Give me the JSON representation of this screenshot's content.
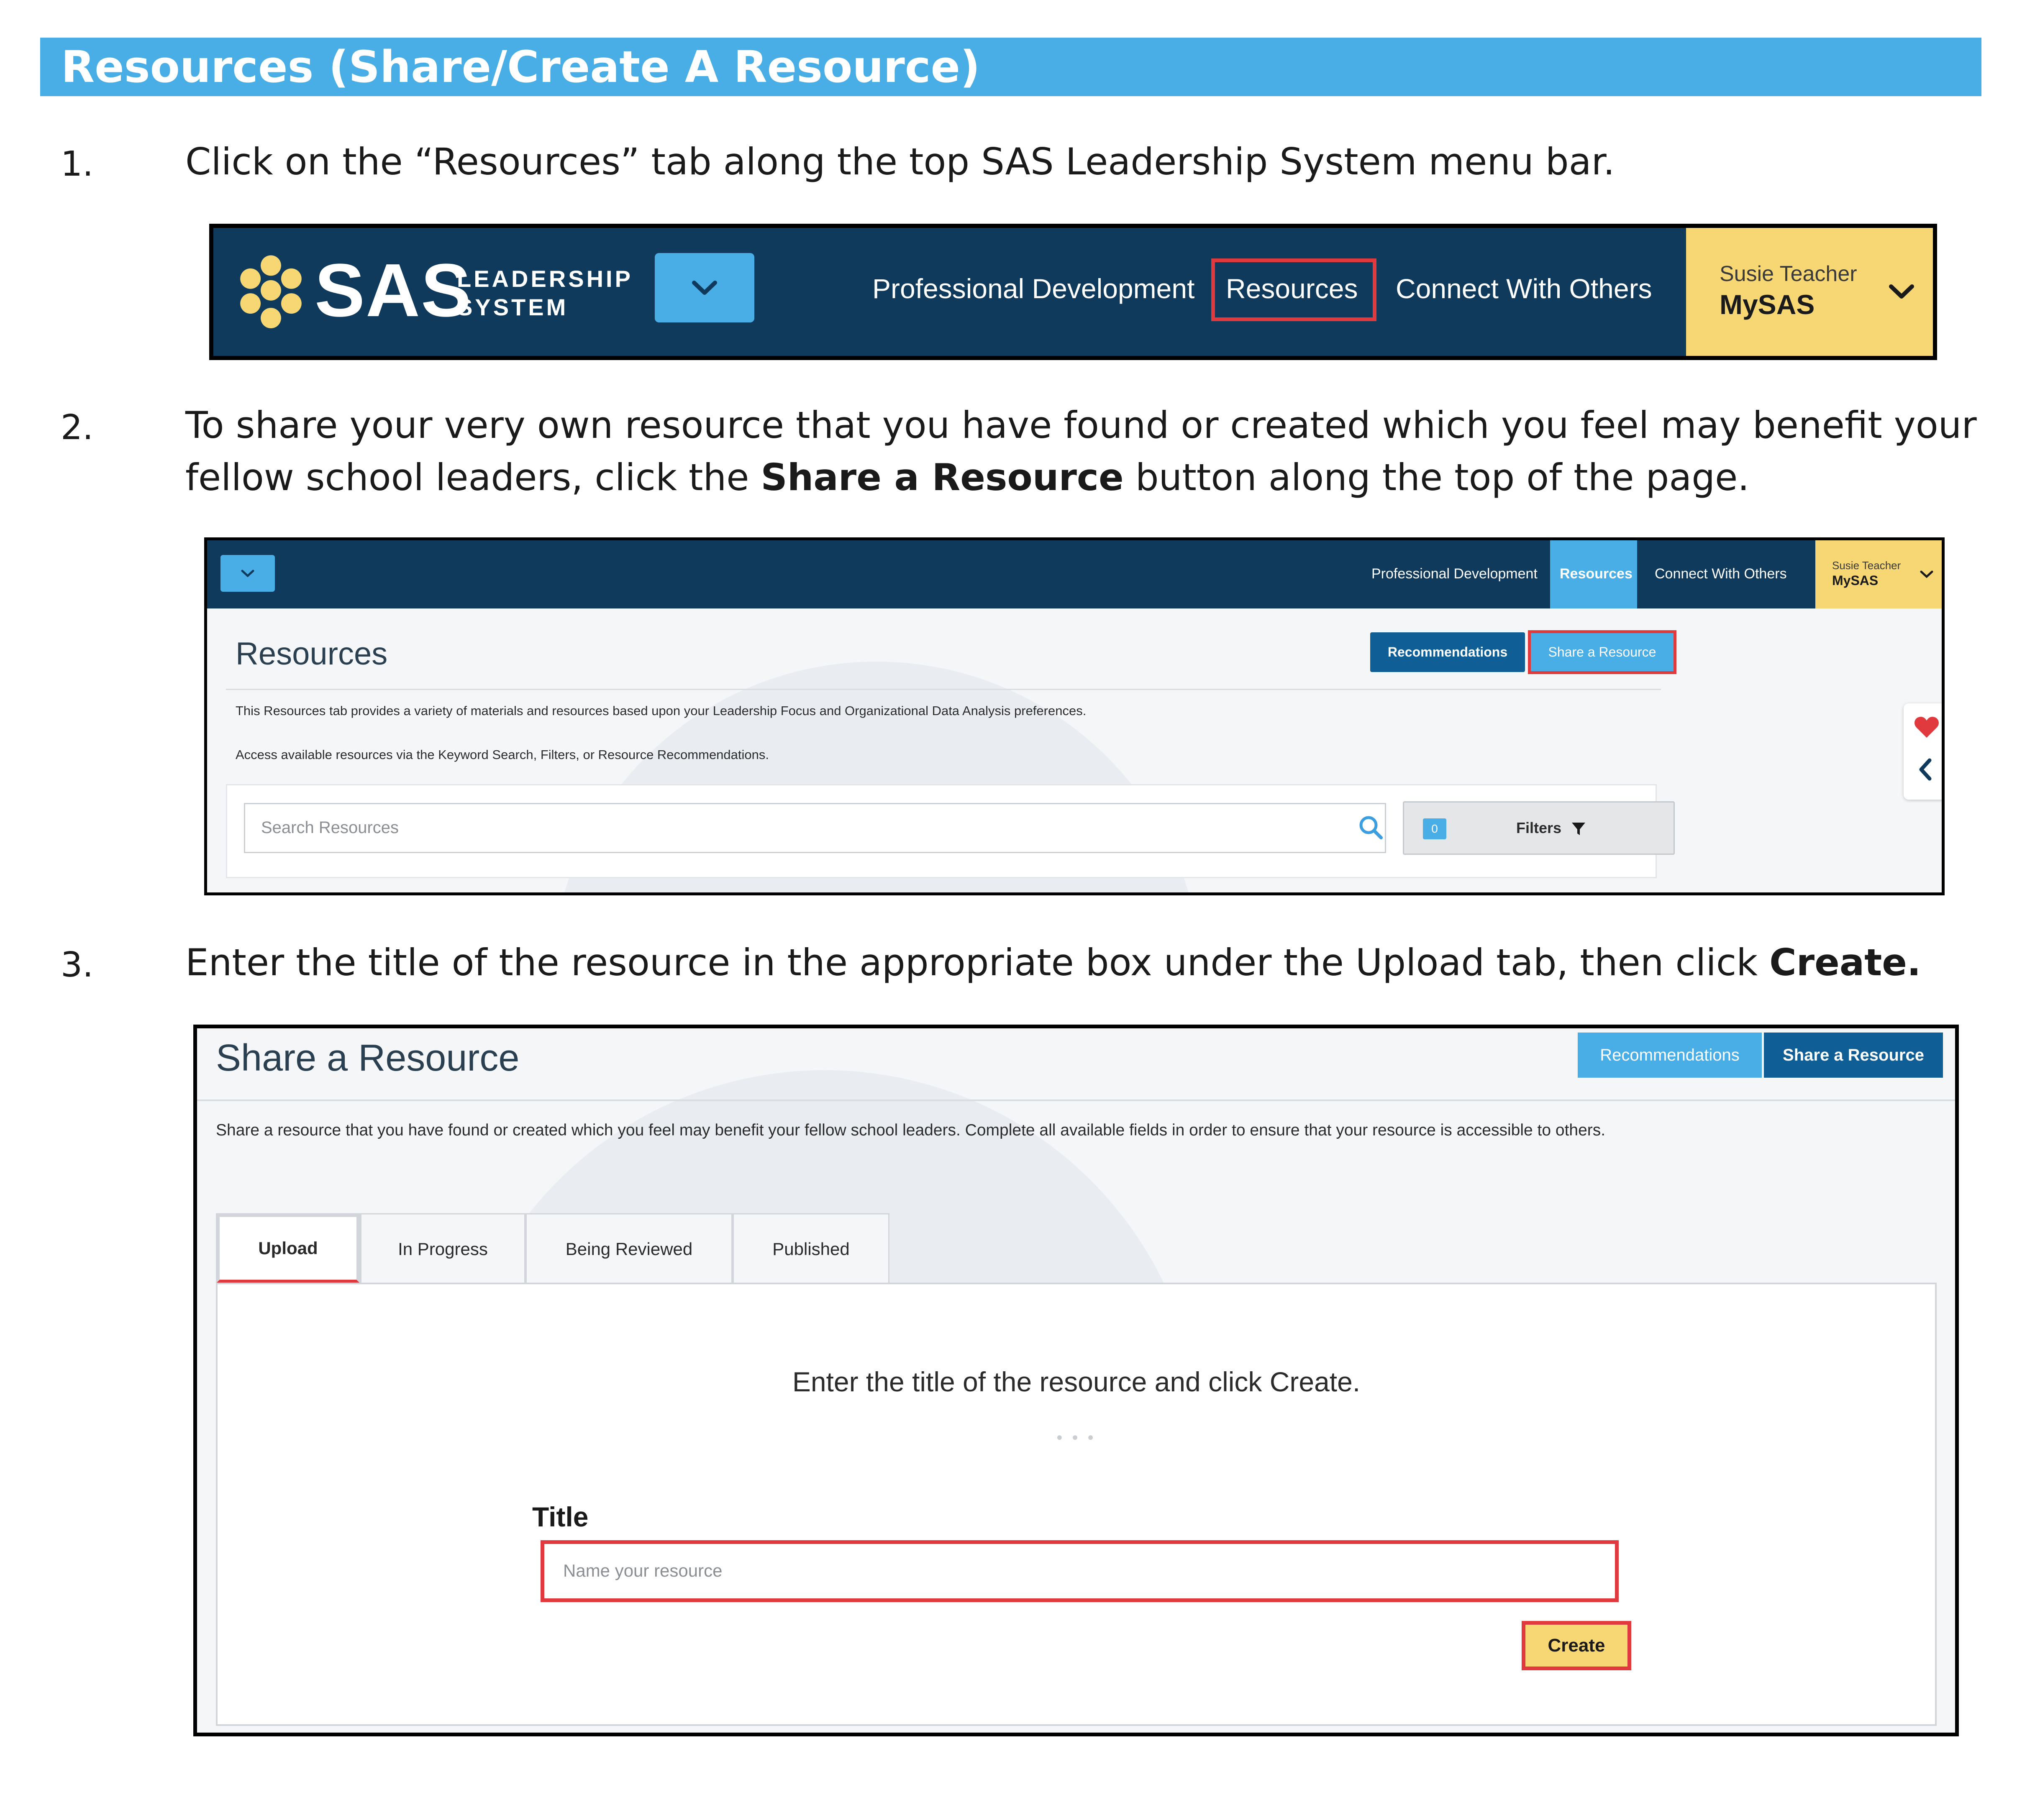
{
  "document": {
    "header": "Resources (Share/Create A Resource)",
    "steps": [
      {
        "number": "1.",
        "line1": "Click on the “Resources” tab along the top SAS Leadership System menu bar."
      },
      {
        "number": "2.",
        "line1": "To share your very own resource that you have found or created which you feel may benefit your",
        "line2_pre": "fellow school leaders, click the ",
        "line2_bold": "Share a Resource",
        "line2_post": " button along the top of the page."
      },
      {
        "number": "3.",
        "line1_pre": "Enter the title of the resource in the appropriate box under the Upload tab, then click ",
        "line1_bold": "Create."
      }
    ]
  },
  "shot1": {
    "logo_text": "SAS",
    "logo_sub1": "LEADERSHIP",
    "logo_sub2": "SYSTEM",
    "nav": [
      "Professional Development",
      "Resources",
      "Connect With Others"
    ],
    "user_name": "Susie Teacher",
    "user_menu": "MySAS",
    "colors": {
      "navbar": "#0f3a5c",
      "accent": "#4aaee6",
      "user": "#f7d774",
      "highlight": "#e03a3e"
    }
  },
  "shot2": {
    "nav": [
      "Professional Development",
      "Resources",
      "Connect With Others"
    ],
    "user_name": "Susie Teacher",
    "user_menu": "MySAS",
    "page_title": "Resources",
    "recommendations_label": "Recommendations",
    "share_label": "Share a Resource",
    "desc1": "This Resources tab provides a variety of materials and resources based upon your Leadership Focus and Organizational Data Analysis preferences.",
    "desc2": "Access available resources via the Keyword Search, Filters, or Resource Recommendations.",
    "search_placeholder": "Search Resources",
    "filter_count": "0",
    "filters_label": "Filters"
  },
  "shot3": {
    "page_title": "Share a Resource",
    "recommendations_label": "Recommendations",
    "share_label": "Share a Resource",
    "description": "Share a resource that you have found or created which you feel may benefit your fellow school leaders. Complete all available fields in order to ensure that your resource is accessible to others.",
    "tabs": [
      "Upload",
      "In Progress",
      "Being Reviewed",
      "Published"
    ],
    "instruction": "Enter the title of the resource and click Create.",
    "title_label": "Title",
    "title_placeholder": "Name your resource",
    "create_label": "Create"
  }
}
